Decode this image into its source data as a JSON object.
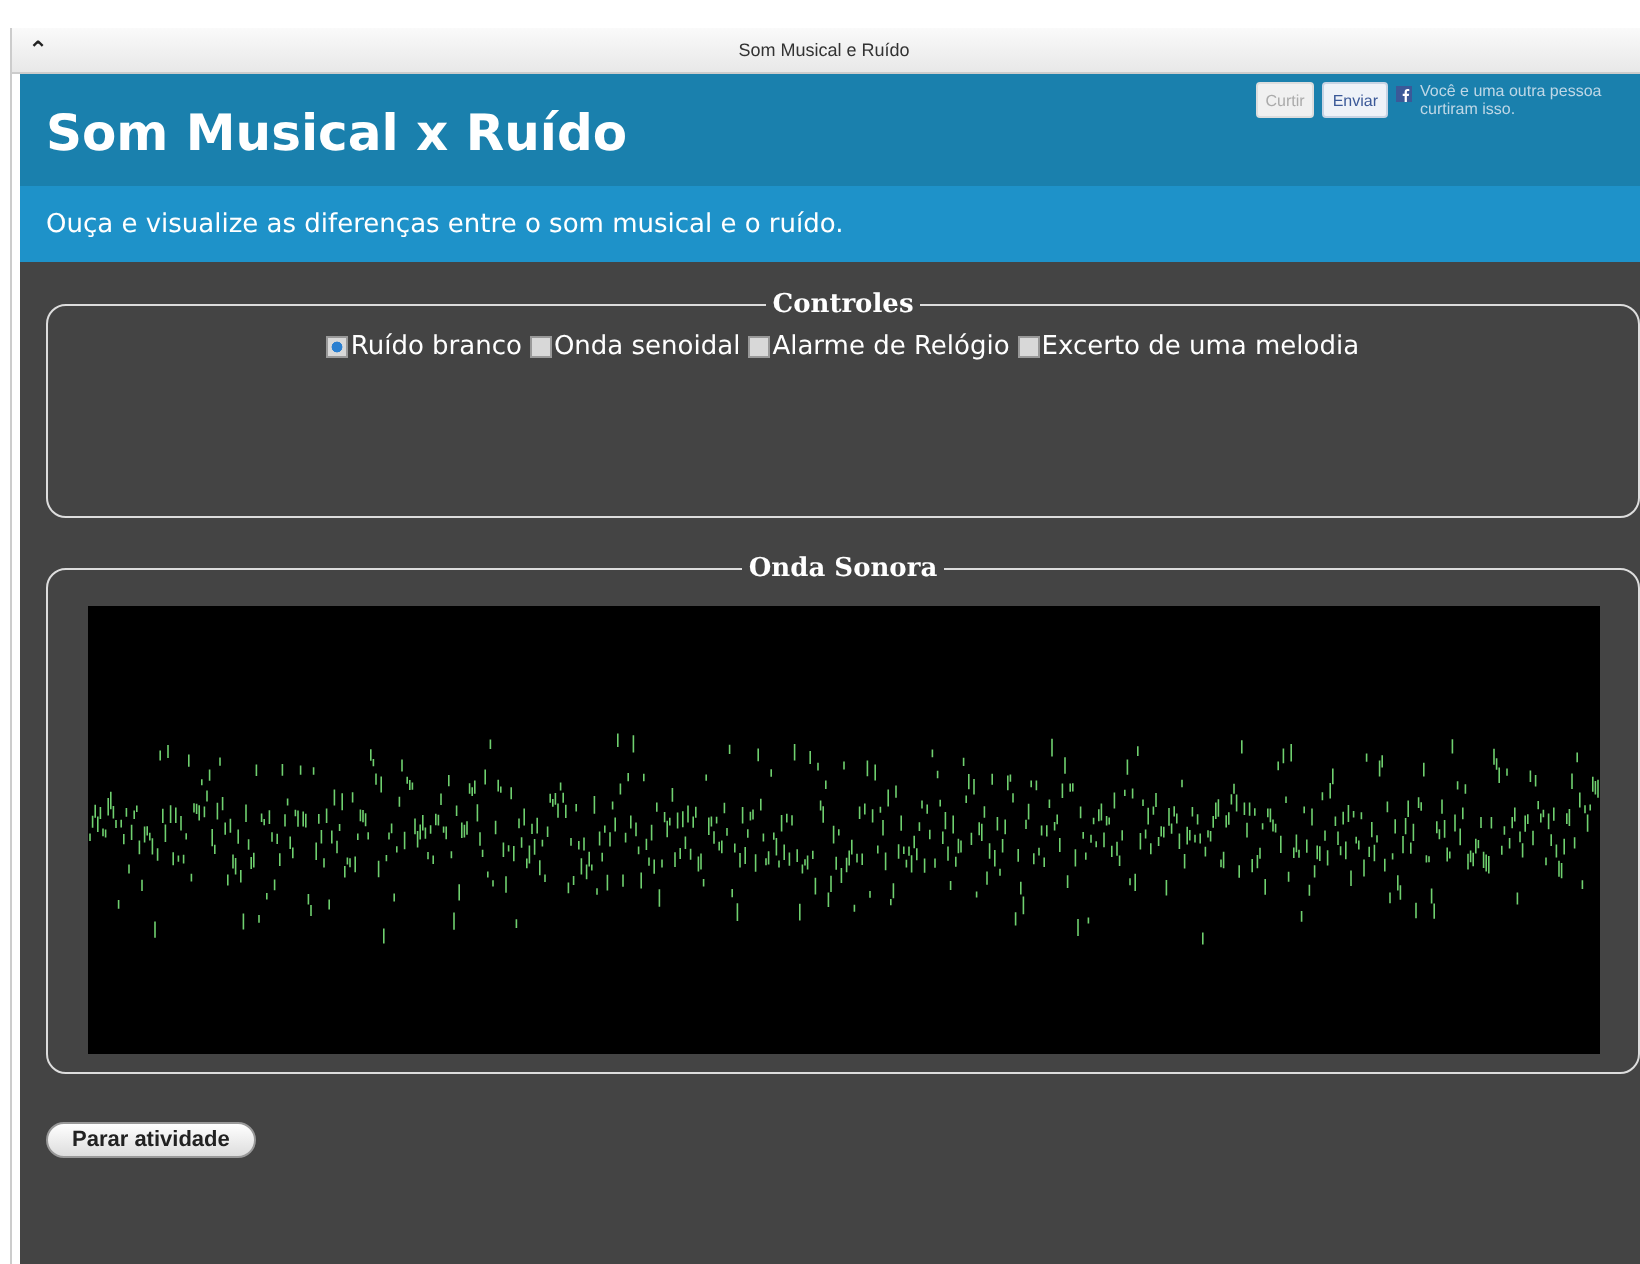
{
  "window": {
    "title": "Som Musical e Ruído",
    "collapse_glyph": "⌃"
  },
  "header": {
    "title": "Som Musical x Ruído",
    "subtitle": "Ouça e visualize as diferenças entre o som musical e o ruído."
  },
  "social": {
    "like": {
      "label": "Curtir",
      "disabled": true
    },
    "send": {
      "label": "Enviar"
    },
    "text": "Você e uma outra pessoa curtiram isso."
  },
  "controls": {
    "legend": "Controles",
    "options": [
      {
        "label": "Ruído branco",
        "selected": true
      },
      {
        "label": "Onda senoidal",
        "selected": false
      },
      {
        "label": "Alarme de Relógio",
        "selected": false
      },
      {
        "label": "Excerto de uma melodia",
        "selected": false
      }
    ]
  },
  "wave": {
    "legend": "Onda Sonora"
  },
  "stop_button": "Parar atividade"
}
